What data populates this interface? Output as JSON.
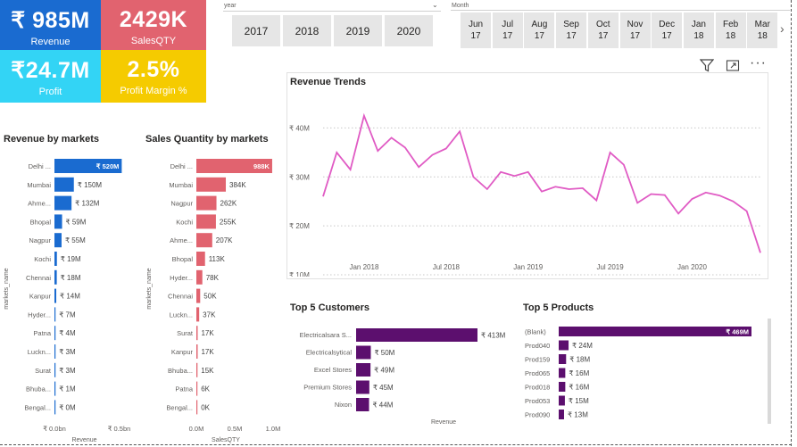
{
  "kpis": {
    "revenue": {
      "value": "₹ 985M",
      "label": "Revenue",
      "color": "#1a6bd0"
    },
    "sales_qty": {
      "value": "2429K",
      "label": "SalesQTY",
      "color": "#e1636f"
    },
    "profit": {
      "value": "₹24.7M",
      "label": "Profit",
      "color": "#33d4f5"
    },
    "profit_margin": {
      "value": "2.5%",
      "label": "Profit Margin  %",
      "color": "#f5cb00"
    }
  },
  "slicers": {
    "year": {
      "title": "year",
      "options": [
        "2017",
        "2018",
        "2019",
        "2020"
      ]
    },
    "month": {
      "title": "Month",
      "options": [
        {
          "m": "Jun",
          "y": "17"
        },
        {
          "m": "Jul",
          "y": "17"
        },
        {
          "m": "Aug",
          "y": "17"
        },
        {
          "m": "Sep",
          "y": "17"
        },
        {
          "m": "Oct",
          "y": "17"
        },
        {
          "m": "Nov",
          "y": "17"
        },
        {
          "m": "Dec",
          "y": "17"
        },
        {
          "m": "Jan",
          "y": "18"
        },
        {
          "m": "Feb",
          "y": "18"
        },
        {
          "m": "Mar",
          "y": "18"
        }
      ]
    }
  },
  "toolbar": {
    "icons": [
      "filter-icon",
      "focus-mode-icon",
      "more-options-icon"
    ]
  },
  "chart_data": [
    {
      "id": "revenue_by_markets",
      "type": "bar",
      "title": "Revenue by markets",
      "xlabel": "Revenue",
      "ylabel": "markets_name",
      "xticks": [
        "₹ 0.0bn",
        "₹ 0.5bn"
      ],
      "xlim": [
        0,
        0.6
      ],
      "color": "#1a6bd0",
      "categories": [
        "Delhi ...",
        "Mumbai",
        "Ahme...",
        "Bhopal",
        "Nagpur",
        "Kochi",
        "Chennai",
        "Kanpur",
        "Hyder...",
        "Patna",
        "Luckn...",
        "Surat",
        "Bhuba...",
        "Bengal..."
      ],
      "values": [
        0.52,
        0.15,
        0.132,
        0.059,
        0.055,
        0.019,
        0.018,
        0.014,
        0.007,
        0.004,
        0.003,
        0.003,
        0.001,
        0.0
      ],
      "labels": [
        "₹ 520M",
        "₹ 150M",
        "₹ 132M",
        "₹ 59M",
        "₹ 55M",
        "₹ 19M",
        "₹ 18M",
        "₹ 14M",
        "₹ 7M",
        "₹ 4M",
        "₹ 3M",
        "₹ 3M",
        "₹ 1M",
        "₹ 0M"
      ]
    },
    {
      "id": "sales_qty_by_markets",
      "type": "bar",
      "title": "Sales Quantity by markets",
      "xlabel": "SalesQTY",
      "ylabel": "markets_name",
      "xticks": [
        "0.0M",
        "0.5M",
        "1.0M"
      ],
      "xlim": [
        0,
        1.0
      ],
      "color": "#e1636f",
      "categories": [
        "Delhi ...",
        "Mumbai",
        "Nagpur",
        "Kochi",
        "Ahme...",
        "Bhopal",
        "Hyder...",
        "Chennai",
        "Luckn...",
        "Surat",
        "Kanpur",
        "Bhuba...",
        "Patna",
        "Bengal..."
      ],
      "values": [
        0.988,
        0.384,
        0.262,
        0.255,
        0.207,
        0.113,
        0.078,
        0.05,
        0.037,
        0.017,
        0.017,
        0.015,
        0.006,
        0.0
      ],
      "labels": [
        "988K",
        "384K",
        "262K",
        "255K",
        "207K",
        "113K",
        "78K",
        "50K",
        "37K",
        "17K",
        "17K",
        "15K",
        "6K",
        "0K"
      ]
    },
    {
      "id": "revenue_trends",
      "type": "line",
      "title": "Revenue Trends",
      "color": "#e05bc4",
      "yticks": [
        "₹ 40M",
        "₹ 30M",
        "₹ 20M",
        "₹ 10M"
      ],
      "ylim": [
        10,
        45
      ],
      "xticks": [
        "Jan 2018",
        "Jul 2018",
        "Jan 2019",
        "Jul 2019",
        "Jan 2020"
      ],
      "x": [
        "2017-10",
        "2017-11",
        "2017-12",
        "2018-01",
        "2018-02",
        "2018-03",
        "2018-04",
        "2018-05",
        "2018-06",
        "2018-07",
        "2018-08",
        "2018-09",
        "2018-10",
        "2018-11",
        "2018-12",
        "2019-01",
        "2019-02",
        "2019-03",
        "2019-04",
        "2019-05",
        "2019-06",
        "2019-07",
        "2019-08",
        "2019-09",
        "2019-10",
        "2019-11",
        "2019-12",
        "2020-01",
        "2020-02",
        "2020-03",
        "2020-04",
        "2020-05",
        "2020-06"
      ],
      "values": [
        26,
        35,
        31.5,
        42.5,
        35.3,
        38,
        36,
        32,
        34.5,
        35.8,
        39.3,
        30,
        27.5,
        31,
        30.2,
        31,
        27,
        28,
        27.5,
        27.7,
        25.2,
        35,
        32.5,
        24.7,
        26.5,
        26.3,
        22.5,
        25.5,
        26.8,
        26.2,
        25,
        23,
        14.5
      ]
    },
    {
      "id": "top5_customers",
      "type": "bar",
      "title": "Top 5 Customers",
      "xlabel": "Revenue",
      "xlim": [
        0,
        450
      ],
      "color": "#5c0f6e",
      "categories": [
        "Electricalsara S...",
        "Electricalsytical",
        "Excel Stores",
        "Premium Stores",
        "Nixon"
      ],
      "values": [
        413,
        50,
        49,
        45,
        44
      ],
      "labels": [
        "₹ 413M",
        "₹ 50M",
        "₹ 49M",
        "₹ 45M",
        "₹ 44M"
      ]
    },
    {
      "id": "top5_products",
      "type": "bar",
      "title": "Top 5 Products",
      "xlim": [
        0,
        490
      ],
      "color": "#5c0f6e",
      "categories": [
        "(Blank)",
        "Prod040",
        "Prod159",
        "Prod065",
        "Prod018",
        "Prod053",
        "Prod090"
      ],
      "values": [
        469,
        24,
        18,
        16,
        16,
        15,
        13
      ],
      "labels": [
        "₹ 469M",
        "₹ 24M",
        "₹ 18M",
        "₹ 16M",
        "₹ 16M",
        "₹ 15M",
        "₹ 13M"
      ]
    }
  ]
}
